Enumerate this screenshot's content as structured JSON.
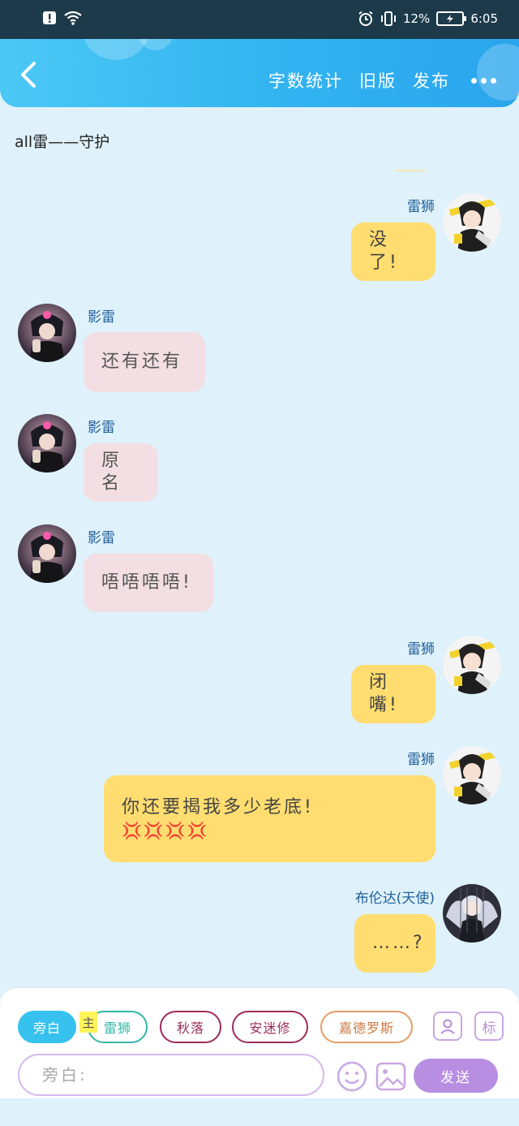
{
  "status_bar": {
    "battery_percent": "12%",
    "time": "6:05"
  },
  "header": {
    "word_count_label": "字数统计",
    "old_version_label": "旧版",
    "publish_label": "发布"
  },
  "story": {
    "title": "all雷——守护"
  },
  "messages": [
    {
      "side": "right",
      "name": "雷狮",
      "text": "没了!"
    },
    {
      "side": "left",
      "name": "影雷",
      "text": "还有还有"
    },
    {
      "side": "left",
      "name": "影雷",
      "text": "原名"
    },
    {
      "side": "left",
      "name": "影雷",
      "text": "唔唔唔唔!"
    },
    {
      "side": "right",
      "name": "雷狮",
      "text": "闭嘴!"
    },
    {
      "side": "right",
      "name": "雷狮",
      "text": "你还要揭我多少老底!",
      "emoji": "💢💢💢💢"
    },
    {
      "side": "right",
      "name": "布伦达(天使)",
      "text": "……?"
    }
  ],
  "composer": {
    "chips": [
      "旁白",
      "雷狮",
      "秋落",
      "安迷修",
      "嘉德罗斯"
    ],
    "main_tag": "主",
    "tag_button_label": "标",
    "input_placeholder": "旁白:",
    "send_label": "发送"
  },
  "colors": {
    "header_blue": "#33b5f0",
    "page_bg": "#dff1fa",
    "yellow_bubble": "#ffdd70",
    "pink_bubble": "#f3dfe3",
    "send_purple": "#b88ee3"
  }
}
